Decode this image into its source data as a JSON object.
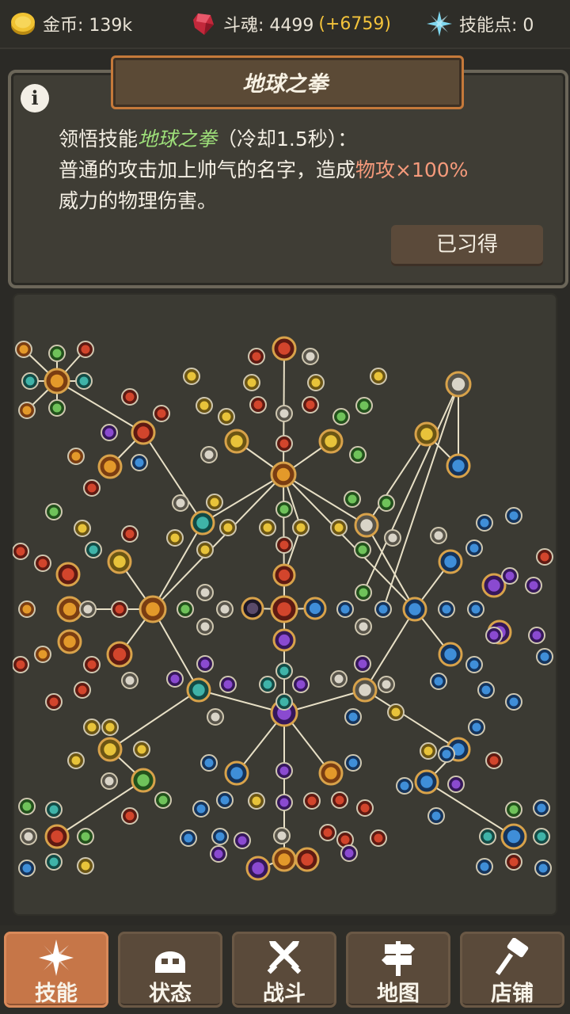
{
  "resources": {
    "gold": {
      "label": "金币: 139k",
      "icon": "gold-coin-icon"
    },
    "soul": {
      "label": "斗魂: 4499",
      "bonus": "(+6759)",
      "icon": "red-crystal-icon"
    },
    "skill_points": {
      "label": "技能点: 0",
      "icon": "sparkle-star-icon"
    }
  },
  "panel": {
    "title": "地球之拳",
    "info_icon": "i",
    "desc_prefix": "领悟技能",
    "desc_skill": "地球之拳",
    "desc_cooldown": "（冷却1.5秒）：",
    "desc_line2": "普通的攻击加上帅气的名字，造成",
    "desc_dmg": "物攻×100%",
    "desc_line3": "威力的物理伤害。",
    "learned_button": "已习得"
  },
  "colors": {
    "accent": "#c67648",
    "skill_name": "#9ee07a",
    "damage_text": "#f59a7b",
    "soul_bonus": "#f3c33b"
  },
  "nav": [
    {
      "label": "技能",
      "icon": "sparkle-icon",
      "active": true
    },
    {
      "label": "状态",
      "icon": "helmet-icon",
      "active": false
    },
    {
      "label": "战斗",
      "icon": "crossed-swords-icon",
      "active": false
    },
    {
      "label": "地图",
      "icon": "signpost-icon",
      "active": false
    },
    {
      "label": "店铺",
      "icon": "hammer-icon",
      "active": false
    }
  ]
}
